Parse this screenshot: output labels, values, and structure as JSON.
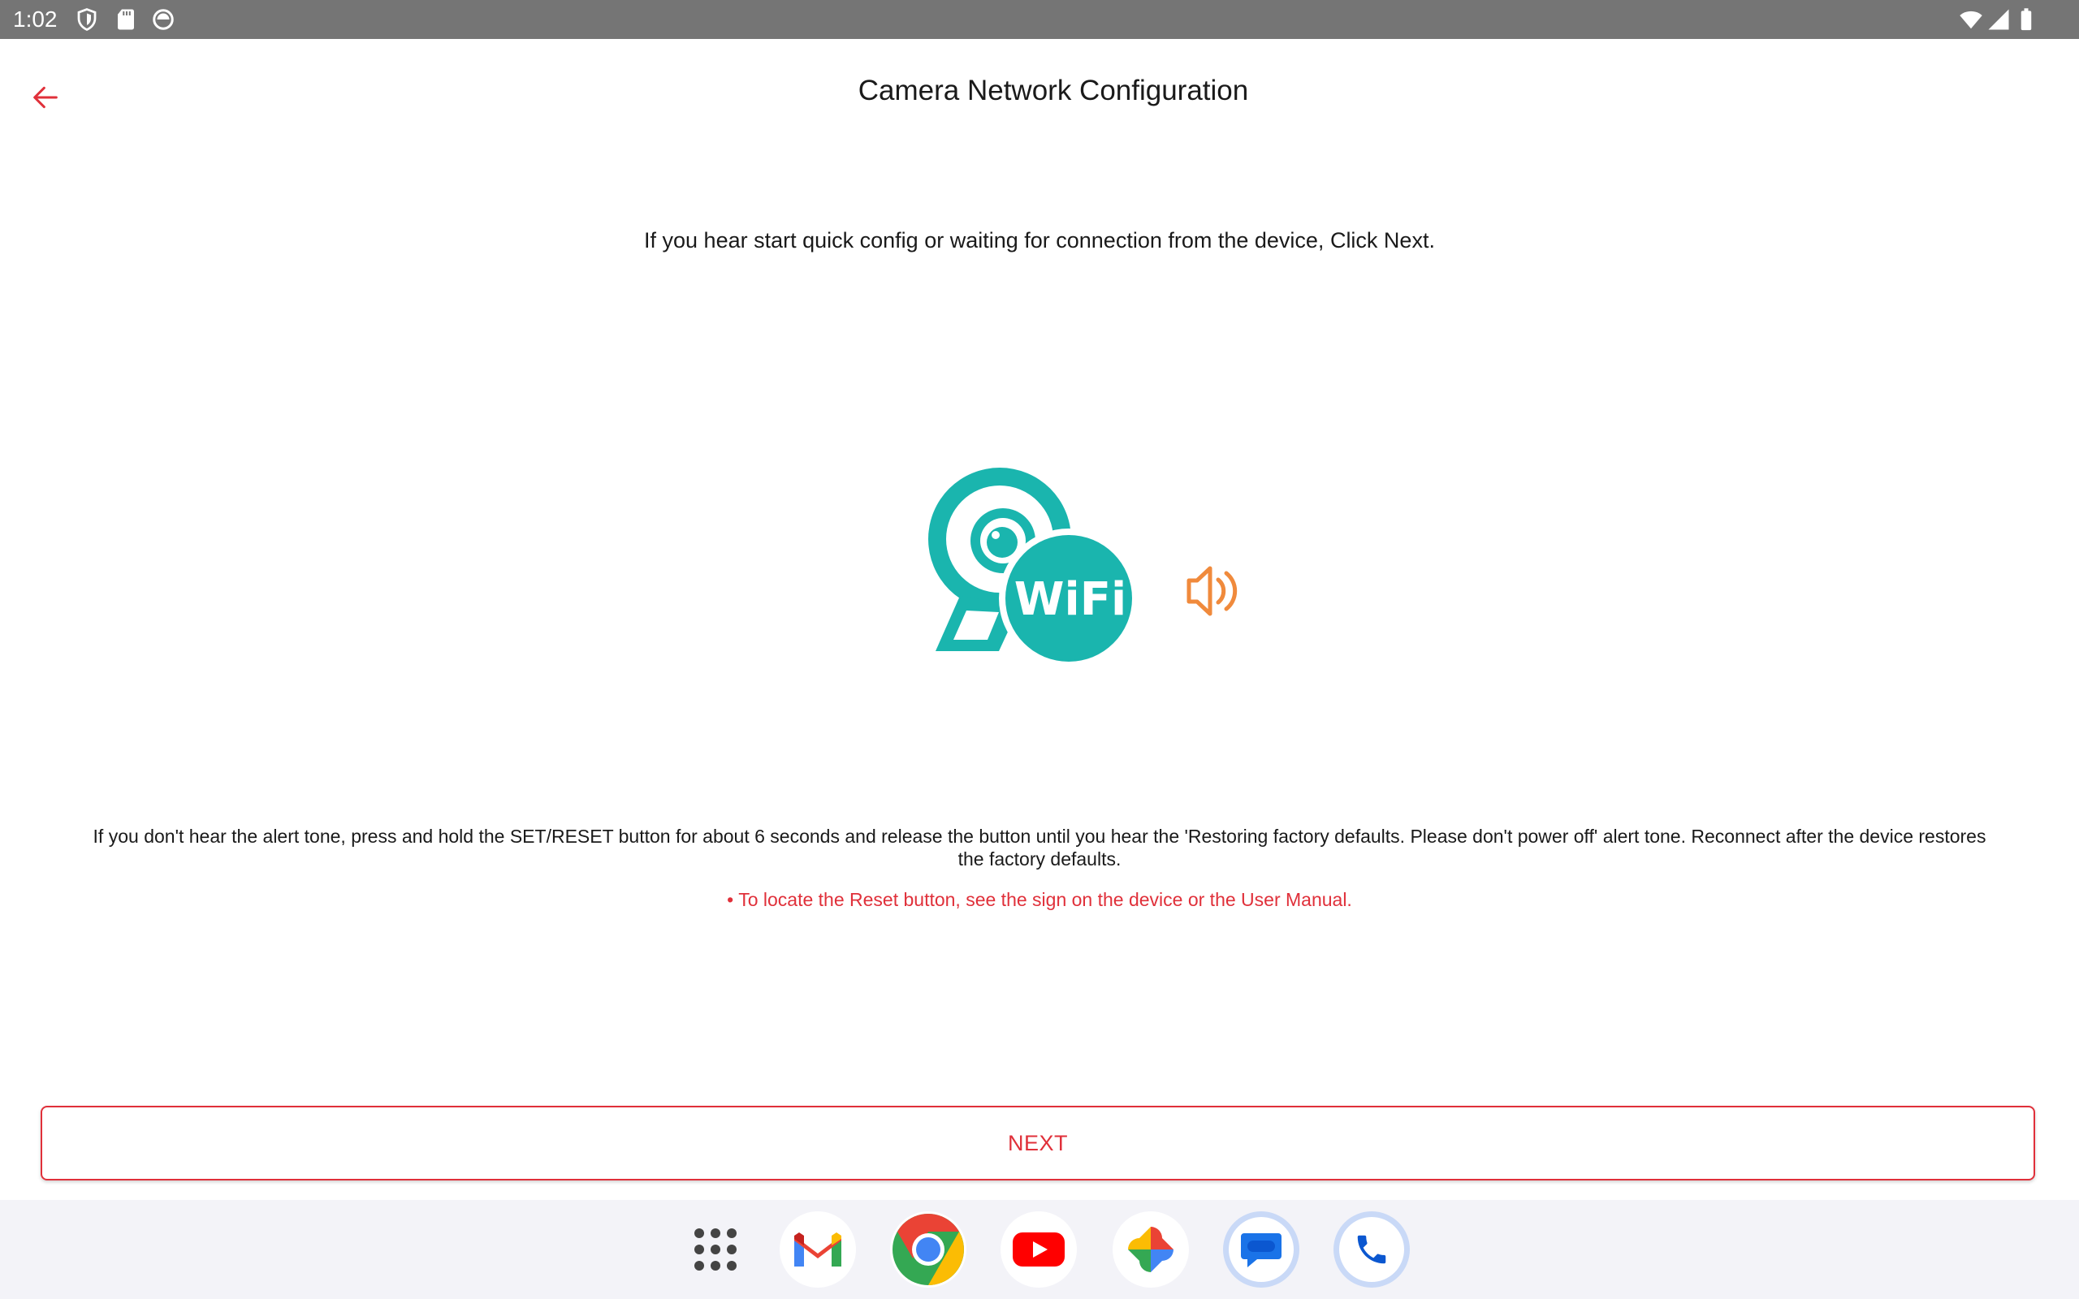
{
  "status_bar": {
    "time": "1:02",
    "left_icons": [
      "shield-icon",
      "sd-card-icon",
      "sync-icon"
    ],
    "right_icons": [
      "wifi-icon",
      "cell-signal-icon",
      "battery-icon"
    ]
  },
  "app_bar": {
    "title": "Camera Network Configuration",
    "back_icon": "arrow-left-icon"
  },
  "main": {
    "instruction": "If you hear start quick config or waiting for connection from the device, Click Next.",
    "illustration": {
      "camera_label": "WiFi",
      "sound_icon": "speaker-icon"
    },
    "help_text": "If you don't hear the alert tone, press and hold the SET/RESET button for about 6 seconds and release the button until you hear the 'Restoring factory defaults. Please don't power off' alert tone. Reconnect after the device restores the factory defaults.",
    "reset_hint": "• To locate the Reset button, see the sign on the device or the User Manual."
  },
  "actions": {
    "next_label": "NEXT"
  },
  "dock": {
    "apps": [
      "app-drawer-icon",
      "gmail-icon",
      "chrome-icon",
      "youtube-icon",
      "photos-icon",
      "messages-icon",
      "phone-icon"
    ]
  },
  "colors": {
    "accent": "#e0303a",
    "teal": "#1ab5ae",
    "speaker": "#f08a3c",
    "status_bar": "#757575"
  }
}
